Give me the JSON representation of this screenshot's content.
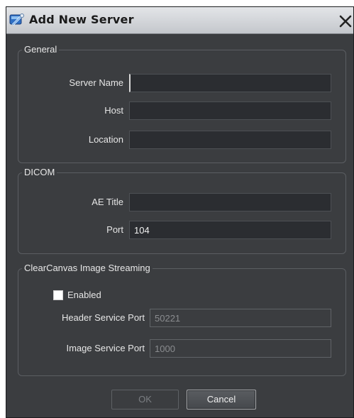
{
  "window": {
    "title": "Add New Server",
    "icon": "server-app-icon",
    "close_icon": "close-icon"
  },
  "general": {
    "legend": "General",
    "server_name_label": "Server Name",
    "server_name_value": "",
    "host_label": "Host",
    "host_value": "",
    "location_label": "Location",
    "location_value": ""
  },
  "dicom": {
    "legend": "DICOM",
    "ae_title_label": "AE Title",
    "ae_title_value": "",
    "port_label": "Port",
    "port_value": "104"
  },
  "streaming": {
    "legend": "ClearCanvas Image Streaming",
    "enabled_label": "Enabled",
    "enabled": false,
    "header_port_label": "Header Service Port",
    "header_port_value": "50221",
    "image_port_label": "Image Service Port",
    "image_port_value": "1000"
  },
  "buttons": {
    "ok_label": "OK",
    "cancel_label": "Cancel"
  },
  "colors": {
    "dialog_background": "#3b3d40",
    "input_background": "#2b2d31",
    "title_bar": "#d4d6d9"
  }
}
